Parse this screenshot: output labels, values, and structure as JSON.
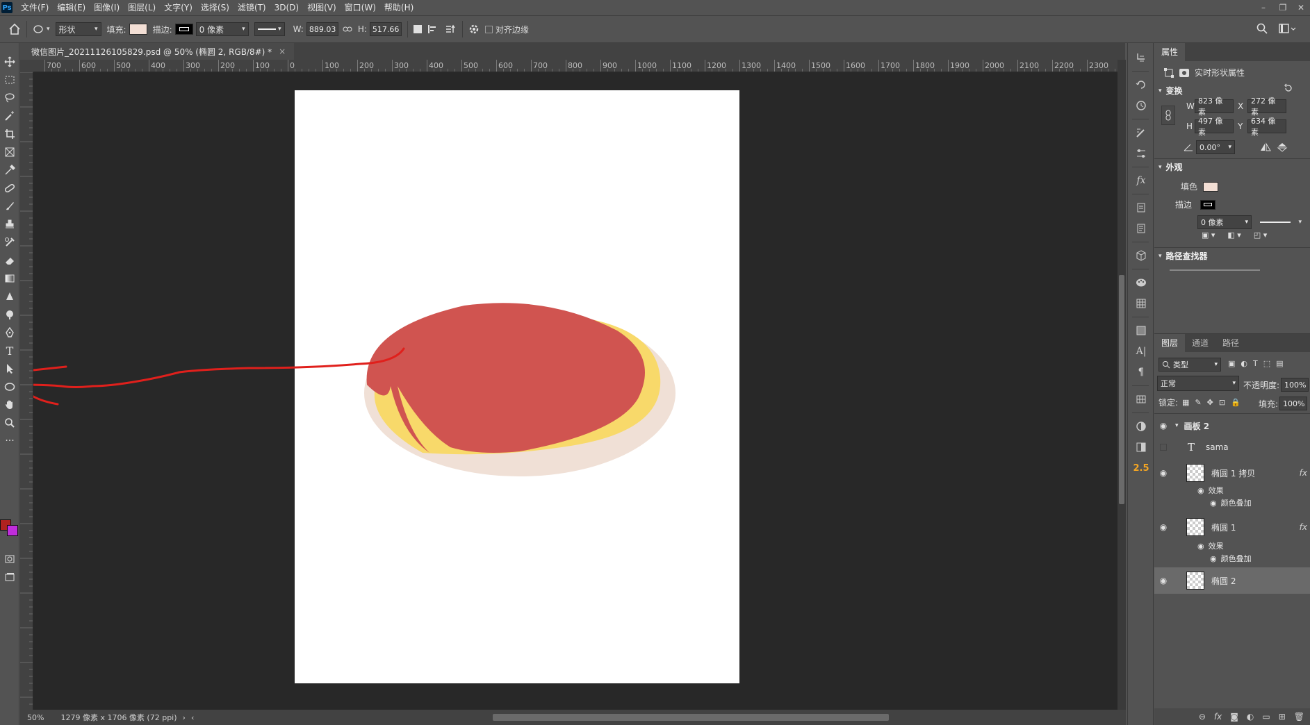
{
  "menu": {
    "logo": "Ps",
    "items": [
      "文件(F)",
      "编辑(E)",
      "图像(I)",
      "图层(L)",
      "文字(Y)",
      "选择(S)",
      "滤镜(T)",
      "3D(D)",
      "视图(V)",
      "窗口(W)",
      "帮助(H)"
    ]
  },
  "options": {
    "mode": "形状",
    "fill_label": "填充:",
    "fill_color": "#f3dfd5",
    "stroke_label": "描边:",
    "stroke_size": "0 像素",
    "w_label": "W:",
    "w_value": "889.03",
    "h_label": "H:",
    "h_value": "517.66",
    "align_edges_label": "对齐边缘"
  },
  "document": {
    "tab_title": "微信图片_20211126105829.psd @ 50% (椭圆 2, RGB/8#) *",
    "ruler_top": [
      "700",
      "600",
      "500",
      "400",
      "300",
      "200",
      "100",
      "0",
      "100",
      "200",
      "300",
      "400",
      "500",
      "600",
      "700",
      "800",
      "900",
      "1000",
      "1100",
      "1200",
      "1300",
      "1400",
      "1500",
      "1600",
      "1700",
      "1800",
      "1900",
      "2000",
      "2100",
      "2200",
      "2300"
    ]
  },
  "canvas": {
    "artboard_color": "#ffffff",
    "background_color": "#282828",
    "shapes": {
      "back_ellipse_color": "#f0e0d6",
      "yellow_color": "#f8d96a",
      "red_color": "#d05450",
      "annotation_color": "#e0201c"
    }
  },
  "status": {
    "zoom": "50%",
    "doc_size": "1279 像素 x 1706 像素 (72 ppi)"
  },
  "toolbar": {
    "fg_color": "#b0221f",
    "bg_color": "#c02ddb"
  },
  "icon_column": {
    "badge": "2.5"
  },
  "properties": {
    "tab": "属性",
    "shape_props": "实时形状属性",
    "transform_head": "变换",
    "w_label": "W",
    "w_value": "823 像素",
    "x_label": "X",
    "x_value": "272 像素",
    "h_label": "H",
    "h_value": "497 像素",
    "y_label": "Y",
    "y_value": "634 像素",
    "angle": "0.00°",
    "appearance_head": "外观",
    "fill_label": "填色",
    "fill_color": "#f3dfd5",
    "stroke_label": "描边",
    "stroke_size": "0 像素",
    "pathfinder_head": "路径查找器"
  },
  "layers": {
    "tabs": [
      "图层",
      "通道",
      "路径"
    ],
    "filter": "类型",
    "blend_mode": "正常",
    "opacity_label": "不透明度:",
    "opacity_value": "100%",
    "lock_label": "锁定:",
    "fill_label": "填充:",
    "fill_value": "100%",
    "items": {
      "artboard": "画板 2",
      "text": "sama",
      "ellipse_copy": "椭圆 1 拷贝",
      "effects": "效果",
      "color_overlay": "颜色叠加",
      "ellipse1": "椭圆 1",
      "ellipse2": "椭圆 2"
    }
  }
}
